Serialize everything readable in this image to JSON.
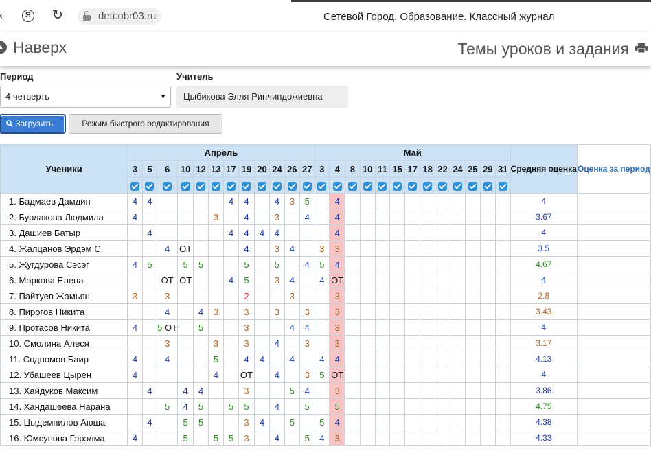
{
  "browser": {
    "back_icon": "back-arrow-icon",
    "yandex_icon": "Я",
    "url": "deti.obr03.ru",
    "title": "Сетевой Город. Образование. Классный журнал"
  },
  "header": {
    "up_label": "Наверх",
    "topics_label": "Темы уроков и задания"
  },
  "form": {
    "period_label": "Период",
    "period_value": "4 четверть",
    "teacher_label": "Учитель",
    "teacher_value": "Цыбикова Элля Ринчиндожиевна",
    "load_button": "Загрузить",
    "quick_edit_button": "Режим быстрого редактирования"
  },
  "table": {
    "students_header": "Ученики",
    "avg_header": "Средняя оценка",
    "final_header": "Оценка за период",
    "months": [
      {
        "name": "Апрель",
        "span": 12
      },
      {
        "name": "Май",
        "span": 13
      }
    ],
    "days": [
      "3",
      "5",
      "6",
      "10",
      "12",
      "13",
      "17",
      "19",
      "20",
      "24",
      "26",
      "27",
      "3",
      "4",
      "8",
      "10",
      "11",
      "15",
      "17",
      "18",
      "22",
      "24",
      "25",
      "29",
      "31"
    ],
    "highlight_col": 13,
    "rows": [
      {
        "name": "1. Бадмаев Дамдин",
        "g": [
          "4",
          "4",
          "",
          "",
          "",
          "",
          "4",
          "4",
          "",
          "4",
          "3",
          "5",
          "",
          "4",
          "",
          "",
          "",
          "",
          "",
          "",
          "",
          "",
          "",
          "",
          ""
        ],
        "avg": "4"
      },
      {
        "name": "2. Бурлакова Людмила",
        "g": [
          "4",
          "",
          "",
          "",
          "",
          "3",
          "",
          "4",
          "",
          "3",
          "",
          "4",
          "",
          "4",
          "",
          "",
          "",
          "",
          "",
          "",
          "",
          "",
          "",
          "",
          ""
        ],
        "avg": "3.67"
      },
      {
        "name": "3. Дашиев Батыр",
        "g": [
          "",
          "4",
          "",
          "",
          "",
          "",
          "4",
          "4",
          "4",
          "4",
          "",
          "",
          "",
          "4",
          "",
          "",
          "",
          "",
          "",
          "",
          "",
          "",
          "",
          "",
          ""
        ],
        "avg": "4"
      },
      {
        "name": "4. Жалцанов Эрдэм С.",
        "g": [
          "",
          "",
          "4",
          "ОТ",
          "",
          "",
          "",
          "4",
          "",
          "3",
          "4",
          "",
          "3",
          "3",
          "",
          "",
          "",
          "",
          "",
          "",
          "",
          "",
          "",
          "",
          ""
        ],
        "avg": "3.5"
      },
      {
        "name": "5. Жугдурова Сэсэг",
        "g": [
          "4",
          "5",
          "",
          "5",
          "5",
          "",
          "",
          "5",
          "",
          "5",
          "",
          "4",
          "5",
          "4",
          "",
          "",
          "",
          "",
          "",
          "",
          "",
          "",
          "",
          "",
          ""
        ],
        "avg": "4.67"
      },
      {
        "name": "6. Маркова Елена",
        "g": [
          "",
          "",
          "ОТ",
          "ОТ",
          "",
          "",
          "4",
          "5",
          "",
          "3",
          "4",
          "",
          "4",
          "ОТ",
          "",
          "",
          "",
          "",
          "",
          "",
          "",
          "",
          "",
          "",
          ""
        ],
        "avg": "4"
      },
      {
        "name": "7. Пайтуев Жамьян",
        "g": [
          "3",
          "",
          "3",
          "",
          "",
          "",
          "",
          "2",
          "",
          "",
          "3",
          "",
          "",
          "3",
          "",
          "",
          "",
          "",
          "",
          "",
          "",
          "",
          "",
          "",
          ""
        ],
        "avg": "2.8"
      },
      {
        "name": "8. Пирогов Никита",
        "g": [
          "",
          "",
          "4",
          "",
          "4",
          "3",
          "",
          "3",
          "",
          "3",
          "",
          "3",
          "",
          "3",
          "",
          "",
          "",
          "",
          "",
          "",
          "",
          "",
          "",
          "",
          ""
        ],
        "avg": "3.43"
      },
      {
        "name": "9. Протасов Никита",
        "g": [
          "4",
          "",
          "5 ОТ",
          "",
          "5",
          "",
          "",
          "3",
          "",
          "",
          "4",
          "4",
          "",
          "3",
          "",
          "",
          "",
          "",
          "",
          "",
          "",
          "",
          "",
          "",
          ""
        ],
        "avg": "4"
      },
      {
        "name": "10. Смолина Алеся",
        "g": [
          "",
          "",
          "3",
          "",
          "",
          "3",
          "",
          "3",
          "",
          "4",
          "",
          "3",
          "",
          "3",
          "",
          "",
          "",
          "",
          "",
          "",
          "",
          "",
          "",
          "",
          ""
        ],
        "avg": "3.17"
      },
      {
        "name": "11. Содномов Баир",
        "g": [
          "4",
          "",
          "4",
          "",
          "",
          "5",
          "",
          "4",
          "4",
          "",
          "4",
          "",
          "4",
          "4",
          "",
          "",
          "",
          "",
          "",
          "",
          "",
          "",
          "",
          "",
          ""
        ],
        "avg": "4.13"
      },
      {
        "name": "12. Убашеев Цырен",
        "g": [
          "4",
          "",
          "",
          "",
          "",
          "4",
          "",
          "ОТ",
          "",
          "4",
          "",
          "3",
          "5",
          "ОТ",
          "",
          "",
          "",
          "",
          "",
          "",
          "",
          "",
          "",
          "",
          ""
        ],
        "avg": "4"
      },
      {
        "name": "13. Хайдуков Максим",
        "g": [
          "",
          "4",
          "",
          "4",
          "4",
          "",
          "",
          "3",
          "",
          "",
          "5",
          "4",
          "",
          "3",
          "",
          "",
          "",
          "",
          "",
          "",
          "",
          "",
          "",
          "",
          ""
        ],
        "avg": "3.86"
      },
      {
        "name": "14. Хандашеева Нарана",
        "g": [
          "",
          "",
          "5",
          "4",
          "5",
          "",
          "5",
          "5",
          "",
          "4",
          "",
          "5",
          "",
          "5",
          "",
          "",
          "",
          "",
          "",
          "",
          "",
          "",
          "",
          "",
          ""
        ],
        "avg": "4.75"
      },
      {
        "name": "15. Цыдемпилов Аюша",
        "g": [
          "",
          "4",
          "",
          "5",
          "5",
          "",
          "",
          "3",
          "4",
          "",
          "5",
          "",
          "5",
          "4",
          "",
          "",
          "",
          "",
          "",
          "",
          "",
          "",
          "",
          "",
          ""
        ],
        "avg": "4.38"
      },
      {
        "name": "16. Юмсунова Гэрэлма",
        "g": [
          "4",
          "",
          "",
          "5",
          "",
          "5",
          "5",
          "3",
          "",
          "4",
          "",
          "5",
          "4",
          "3",
          "",
          "",
          "",
          "",
          "",
          "",
          "",
          "",
          "",
          "",
          ""
        ],
        "avg": "4.33"
      }
    ]
  },
  "colors": {
    "grade5": "#2a8a1f",
    "grade4": "#1c3fa8",
    "grade3": "#b5651d",
    "grade2": "#dd2222",
    "header_bg": "#cde3f5",
    "highlight": "#f6c4c4"
  }
}
